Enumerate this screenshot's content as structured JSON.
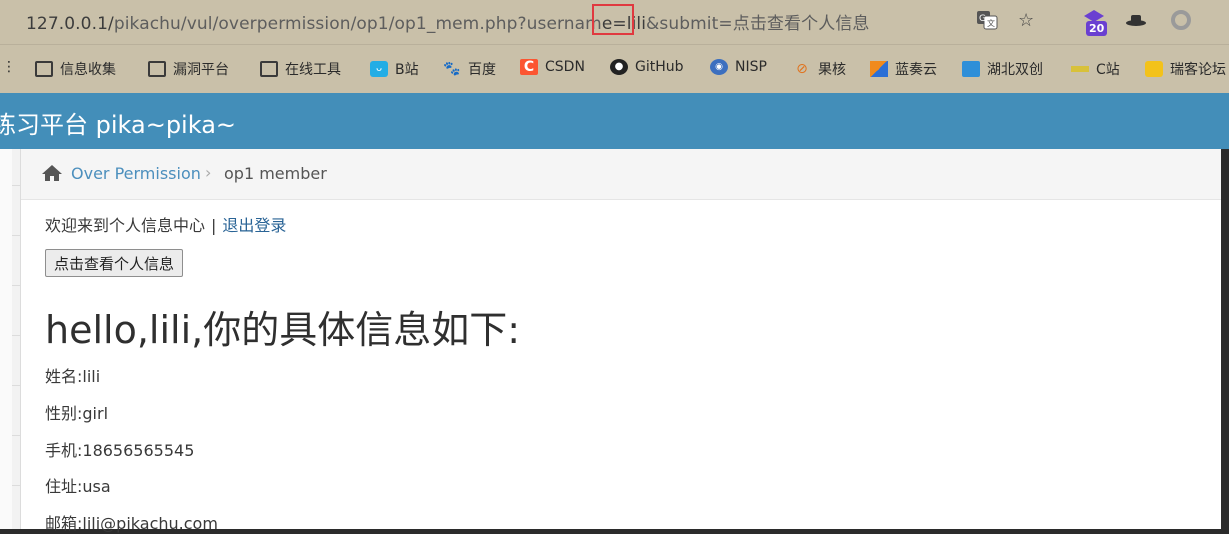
{
  "browser": {
    "url_base": "127.0.0.1/",
    "url_path": "pikachu/vul/overpermission/op1/op1_mem.php?usernam",
    "url_highlight": "e=lili",
    "url_rest": "&submit=点击查看个人信息",
    "extension_badge": "20"
  },
  "bookmarks": [
    {
      "label": "信息收集",
      "icon": "folder-icon"
    },
    {
      "label": "漏洞平台",
      "icon": "folder-icon"
    },
    {
      "label": "在线工具",
      "icon": "folder-icon"
    },
    {
      "label": "B站",
      "icon": "bilibili-icon"
    },
    {
      "label": "百度",
      "icon": "baidu-icon"
    },
    {
      "label": "CSDN",
      "icon": "csdn-icon"
    },
    {
      "label": "GitHub",
      "icon": "github-icon"
    },
    {
      "label": "NISP",
      "icon": "nisp-icon"
    },
    {
      "label": "果核",
      "icon": "guohe-icon"
    },
    {
      "label": "蓝奏云",
      "icon": "lanzou-icon"
    },
    {
      "label": "湖北双创",
      "icon": "hubei-icon"
    },
    {
      "label": "C站",
      "icon": "c-site-icon"
    },
    {
      "label": "瑞客论坛",
      "icon": "ruike-icon"
    }
  ],
  "site": {
    "title": "练习平台 pika~pika~"
  },
  "breadcrumb": {
    "home_icon": "home-icon",
    "link": "Over Permission",
    "separator": "›",
    "current": "op1 member"
  },
  "main": {
    "welcome": "欢迎来到个人信息中心",
    "separator": "|",
    "logout": "退出登录",
    "view_button": "点击查看个人信息",
    "hello": "hello,lili,你的具体信息如下:",
    "info": [
      "姓名:lili",
      "性别:girl",
      "手机:18656565545",
      "住址:usa",
      "邮箱:lili@pikachu.com"
    ]
  },
  "colors": {
    "topbar": "#438eb9",
    "link": "#4c8fbd",
    "chrome": "#c9c0a9",
    "highlight_box": "#e0393f"
  }
}
